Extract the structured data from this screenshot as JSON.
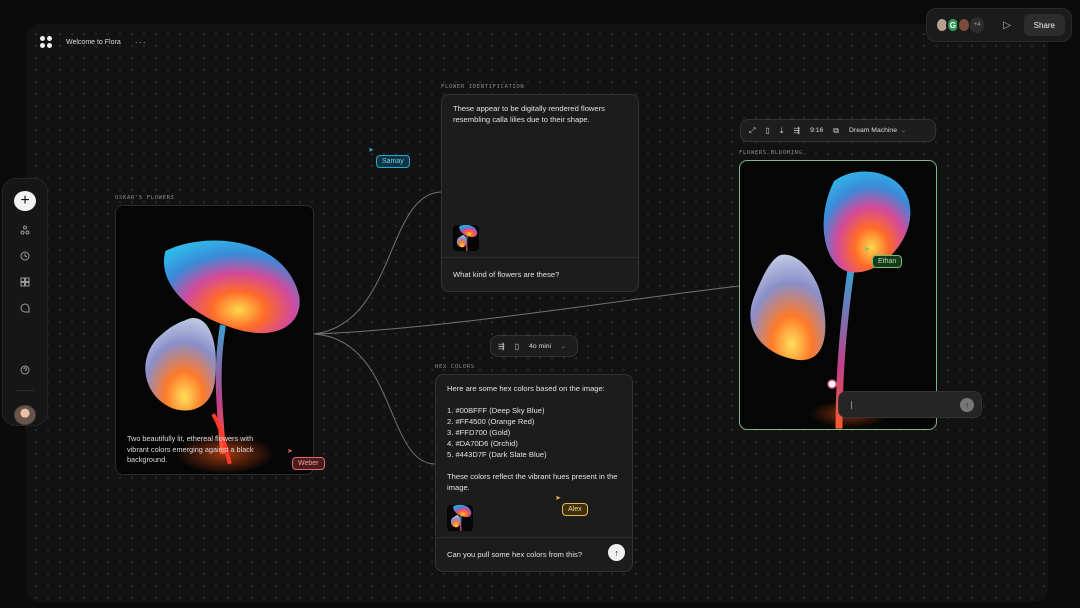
{
  "window": {
    "title": "Welcome to Flora",
    "more": "···"
  },
  "sharebar": {
    "avatars": [
      {
        "initial": "",
        "color": "#b9a093"
      },
      {
        "initial": "G",
        "color": "#2f9a55"
      },
      {
        "initial": "",
        "color": "#7a4e3c"
      }
    ],
    "extra_count": "+4",
    "share_label": "Share"
  },
  "sidebar": {
    "add": "+",
    "icons": [
      "nodes-icon",
      "history-icon",
      "assets-icon",
      "comment-icon",
      "help-icon"
    ]
  },
  "nodes": {
    "oskar": {
      "label": "OSKAR'S FLOWERS",
      "caption": "Two beautifully lit, ethereal flowers with vibrant colors emerging against a black background."
    },
    "identification": {
      "label": "FLOWER IDENTIFICATION",
      "response": "These appear to be digitally rendered flowers resembling calla lilies due to their shape.",
      "prompt": "What kind of flowers are these?"
    },
    "hex": {
      "label": "HEX COLORS",
      "intro": "Here are some hex colors based on the image:",
      "colors": [
        "1. #00BFFF (Deep Sky Blue)",
        "2. #FF4500 (Orange Red)",
        "3. #FFD700 (Gold)",
        "4. #DA70D6 (Orchid)",
        "5. #443D7F (Dark Slate Blue)"
      ],
      "outro": "These colors reflect the vibrant hues present in the image.",
      "prompt": "Can you pull some hex colors from this?"
    },
    "blooming": {
      "label": "FLOWERS BLOOMING"
    }
  },
  "model_bar": {
    "model": "4o mini"
  },
  "video_toolbar": {
    "ratio": "9:16",
    "model": "Dream Machine"
  },
  "collaborators": {
    "samay": {
      "name": "Samay",
      "color": "#2aa7d6"
    },
    "weber": {
      "name": "Weber",
      "color": "#e06a6a"
    },
    "ethan": {
      "name": "Ethan",
      "color": "#6bc36f"
    },
    "alex": {
      "name": "Alex",
      "color": "#e5b84a"
    }
  }
}
